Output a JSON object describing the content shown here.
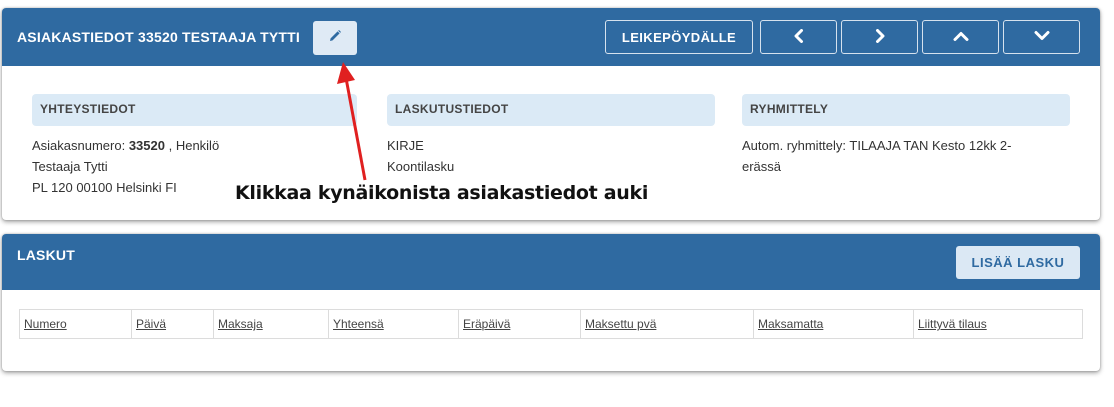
{
  "customer": {
    "title": "ASIAKASTIEDOT 33520 TESTAAJA TYTTI",
    "clipboard_label": "LEIKEPÖYDÄLLE",
    "sections": {
      "contact": {
        "heading": "YHTEYSTIEDOT",
        "number_prefix": "Asiakasnumero: ",
        "number": "33520",
        "number_suffix": " , Henkilö",
        "name": "Testaaja Tytti",
        "address": "PL 120 00100 Helsinki FI"
      },
      "billing": {
        "heading": "LASKUTUSTIEDOT",
        "method": "KIRJE",
        "type": "Koontilasku"
      },
      "grouping": {
        "heading": "RYHMITTELY",
        "text": "Autom. ryhmittely: TILAAJA TAN Kesto 12kk 2-erässä"
      }
    }
  },
  "invoices": {
    "title": "LASKUT",
    "add_label": "LISÄÄ LASKU",
    "columns": [
      "Numero",
      "Päivä",
      "Maksaja",
      "Yhteensä",
      "Eräpäivä",
      "Maksettu pvä",
      "Maksamatta",
      "Liittyvä tilaus"
    ]
  },
  "annotation": {
    "text": "Klikkaa kynäikonista asiakastiedot auki"
  },
  "icons": {
    "edit": "pencil-icon",
    "prev": "chevron-left-icon",
    "next": "chevron-right-icon",
    "up": "chevron-up-icon",
    "down": "chevron-down-icon"
  },
  "colors": {
    "header": "#2f6aa1",
    "section_head": "#dbeaf6",
    "edit_button": "#dfeaf5",
    "annotation_arrow": "#e02020"
  }
}
